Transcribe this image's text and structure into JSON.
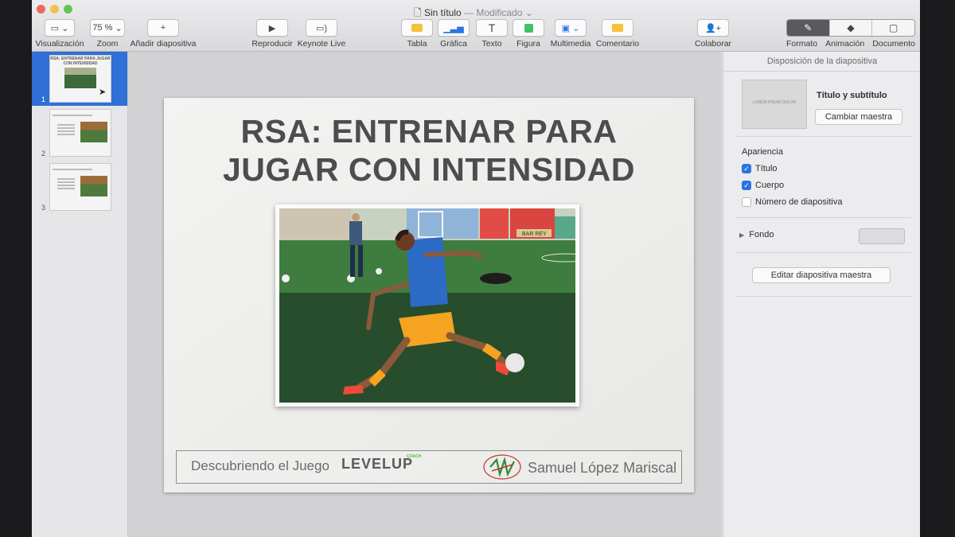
{
  "window": {
    "title": "Sin título",
    "status": "— Modificado",
    "traffic_colors": [
      "#ed6a5e",
      "#f5bf4f",
      "#61c554"
    ]
  },
  "toolbar": {
    "view_label": "Visualización",
    "zoom_value": "75 %",
    "zoom_label": "Zoom",
    "add_slide_label": "Añadir diapositiva",
    "play_label": "Reproducir",
    "keynote_live_label": "Keynote Live",
    "table_label": "Tabla",
    "chart_label": "Gráfica",
    "text_label": "Texto",
    "shape_label": "Figura",
    "media_label": "Multimedia",
    "comment_label": "Comentario",
    "collaborate_label": "Colaborar",
    "format_label": "Formato",
    "animate_label": "Animación",
    "document_label": "Documento",
    "accent_color": "#f5c23c"
  },
  "navigator": {
    "slides": [
      {
        "number": "1",
        "title": "RSA: ENTRENAR PARA JUGAR CON INTENSIDAD"
      },
      {
        "number": "2",
        "title": ""
      },
      {
        "number": "3",
        "title": ""
      }
    ]
  },
  "slide": {
    "title_line1": "RSA: ENTRENAR PARA",
    "title_line2": "JUGAR CON INTENSIDAD",
    "footer_left": "Descubriendo el Juego",
    "brand_name": "LEVELUP",
    "brand_tag": "COACH",
    "footer_right": "Samuel López Mariscal",
    "banner_text": "BAR REY"
  },
  "inspector": {
    "header": "Disposición de la diapositiva",
    "master_name": "Título y subtítulo",
    "master_thumb_text": "LOREM IPSUM DOLOR",
    "change_master": "Cambiar maestra",
    "appearance_label": "Apariencia",
    "options": [
      {
        "label": "Título",
        "checked": true
      },
      {
        "label": "Cuerpo",
        "checked": true
      },
      {
        "label": "Número de diapositiva",
        "checked": false
      }
    ],
    "background_label": "Fondo",
    "edit_master": "Editar diapositiva maestra"
  }
}
